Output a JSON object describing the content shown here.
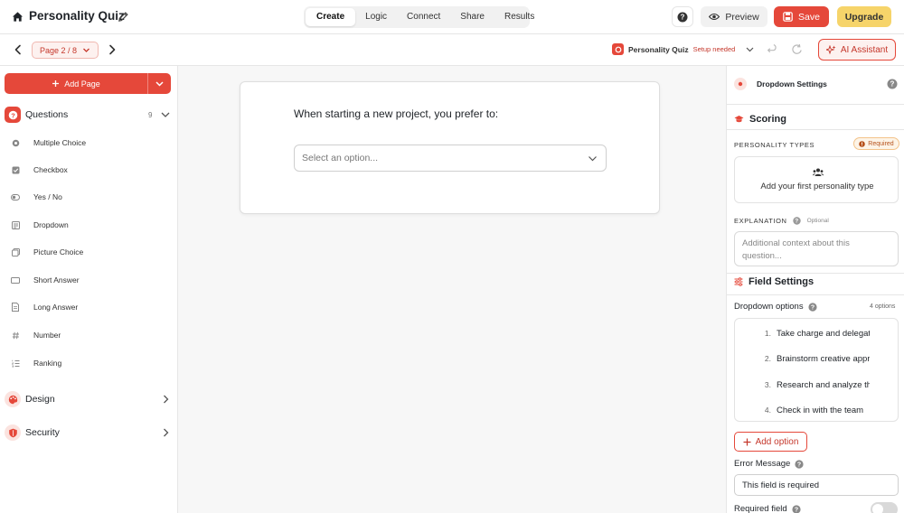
{
  "header": {
    "title": "Personality Quiz",
    "tabs": [
      {
        "label": "Create",
        "active": true
      },
      {
        "label": "Logic",
        "active": false
      },
      {
        "label": "Connect",
        "active": false
      },
      {
        "label": "Share",
        "active": false
      },
      {
        "label": "Results",
        "active": false
      }
    ],
    "preview_label": "Preview",
    "save_label": "Save",
    "upgrade_label": "Upgrade"
  },
  "subbar": {
    "page_label": "Page 2 / 8",
    "quiz_name": "Personality Quiz",
    "quiz_status": "Setup needed",
    "ai_label": "AI Assistant"
  },
  "sidebar": {
    "add_page_label": "Add Page",
    "questions_label": "Questions",
    "questions_count": "9",
    "items": [
      {
        "label": "Multiple Choice",
        "icon": "radio-icon"
      },
      {
        "label": "Checkbox",
        "icon": "checkbox-icon"
      },
      {
        "label": "Yes / No",
        "icon": "toggle-icon"
      },
      {
        "label": "Dropdown",
        "icon": "dropdown-icon"
      },
      {
        "label": "Picture Choice",
        "icon": "image-icon"
      },
      {
        "label": "Short Answer",
        "icon": "short-text-icon"
      },
      {
        "label": "Long Answer",
        "icon": "long-text-icon"
      },
      {
        "label": "Number",
        "icon": "hash-icon"
      },
      {
        "label": "Ranking",
        "icon": "ranking-icon"
      }
    ],
    "design_label": "Design",
    "security_label": "Security"
  },
  "canvas": {
    "question_text": "When starting a new project, you prefer to:",
    "select_placeholder": "Select an option..."
  },
  "panel": {
    "title": "Dropdown Settings",
    "scoring_title": "Scoring",
    "personality_types_label": "PERSONALITY TYPES",
    "required_badge": "Required",
    "add_type_text": "Add your first personality type",
    "explanation_label": "EXPLANATION",
    "optional_badge": "Optional",
    "explanation_placeholder": "Additional context about this question...",
    "field_settings_title": "Field Settings",
    "dropdown_options_label": "Dropdown options",
    "options_count": "4 options",
    "options": [
      {
        "num": "1.",
        "text": "Take charge and delegate"
      },
      {
        "num": "2.",
        "text": "Brainstorm creative approaches"
      },
      {
        "num": "3.",
        "text": "Research and analyze thoroughly"
      },
      {
        "num": "4.",
        "text": "Check in with the team"
      }
    ],
    "add_option_label": "Add option",
    "error_message_label": "Error Message",
    "error_message_value": "This field is required",
    "required_field_label": "Required field"
  },
  "colors": {
    "accent": "#e5483a",
    "upgrade": "#f6d46a"
  }
}
